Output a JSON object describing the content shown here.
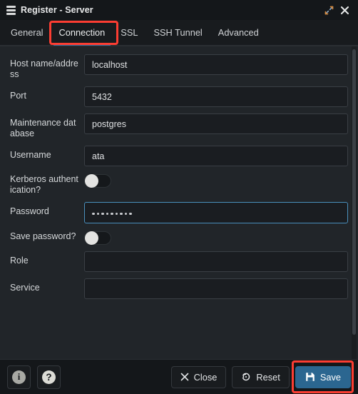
{
  "window": {
    "title": "Register - Server",
    "icon": "server-stack-icon",
    "maximize_icon": "maximize-diagonal-icon",
    "close_icon": "close-x-icon"
  },
  "tabs": {
    "items": [
      {
        "label": "General",
        "active": false
      },
      {
        "label": "Connection",
        "active": true
      },
      {
        "label": "SSL",
        "active": false
      },
      {
        "label": "SSH Tunnel",
        "active": false
      },
      {
        "label": "Advanced",
        "active": false
      }
    ],
    "highlighted": "Connection"
  },
  "form": {
    "fields": [
      {
        "label": "Host name/address",
        "type": "text",
        "value": "localhost"
      },
      {
        "label": "Port",
        "type": "text",
        "value": "5432"
      },
      {
        "label": "Maintenance database",
        "type": "text",
        "value": "postgres"
      },
      {
        "label": "Username",
        "type": "text",
        "value": "ata"
      },
      {
        "label": "Kerberos authentication?",
        "type": "toggle",
        "value": "off"
      },
      {
        "label": "Password",
        "type": "password",
        "value": "•••••••••",
        "dots": 9,
        "focused": true
      },
      {
        "label": "Save password?",
        "type": "toggle",
        "value": "off"
      },
      {
        "label": "Role",
        "type": "text",
        "value": ""
      },
      {
        "label": "Service",
        "type": "text",
        "value": ""
      }
    ]
  },
  "footer": {
    "info_label": "i",
    "help_label": "?",
    "close_label": "Close",
    "reset_label": "Reset",
    "save_label": "Save",
    "highlighted": "Save"
  },
  "colors": {
    "accent_blue": "#2b6690",
    "highlight_red": "#fc3d32",
    "tab_underline": "#2f6f9f",
    "focus_border": "#4a90bd",
    "window_bg": "#212529",
    "chrome_bg": "#14171a"
  }
}
